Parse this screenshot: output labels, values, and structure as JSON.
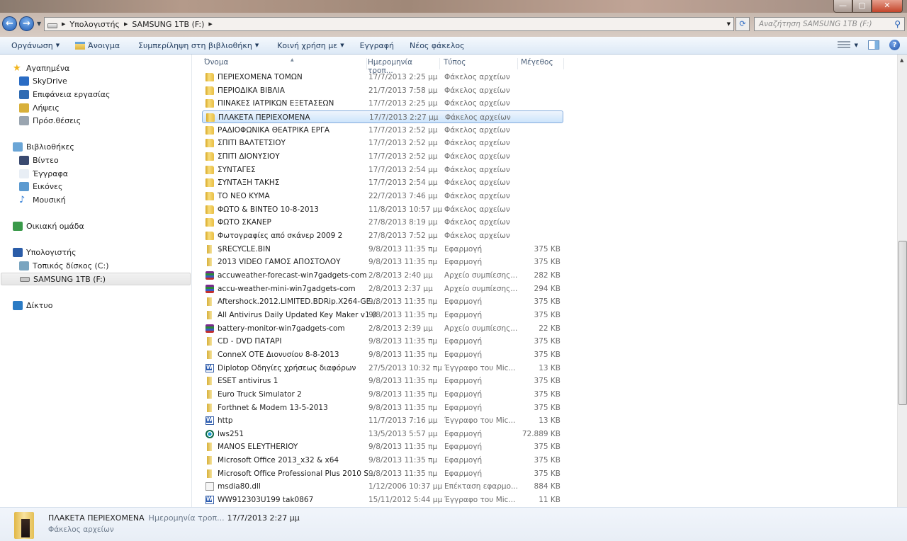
{
  "window": {
    "minimize": "—",
    "maximize": "▢",
    "close": "✕"
  },
  "address": {
    "crumbs": [
      "Υπολογιστής",
      "SAMSUNG 1TB (F:)"
    ]
  },
  "search": {
    "placeholder": "Αναζήτηση SAMSUNG 1TB (F:)"
  },
  "toolbar": {
    "organize": "Οργάνωση",
    "open": "Άνοιγμα",
    "include_library": "Συμπερίληψη στη βιβλιοθήκη",
    "share_with": "Κοινή χρήση με",
    "burn": "Εγγραφή",
    "new_folder": "Νέος φάκελος"
  },
  "nav": {
    "items": [
      {
        "label": "Αγαπημένα",
        "icon": "star-icon",
        "level": 0
      },
      {
        "label": "SkyDrive",
        "icon": "skydrive-icon",
        "level": 1
      },
      {
        "label": "Επιφάνεια εργασίας",
        "icon": "desktop-icon",
        "level": 1
      },
      {
        "label": "Λήψεις",
        "icon": "downloads-icon",
        "level": 1
      },
      {
        "label": "Πρόσ.θέσεις",
        "icon": "recent-places-icon",
        "level": 1
      },
      {
        "label": "Βιβλιοθήκες",
        "icon": "libraries-icon",
        "level": 0
      },
      {
        "label": "Βίντεο",
        "icon": "video-icon",
        "level": 1
      },
      {
        "label": "Έγγραφα",
        "icon": "documents-icon",
        "level": 1
      },
      {
        "label": "Εικόνες",
        "icon": "pictures-icon",
        "level": 1
      },
      {
        "label": "Μουσική",
        "icon": "music-icon",
        "level": 1
      },
      {
        "label": "Οικιακή ομάδα",
        "icon": "homegroup-icon",
        "level": 0
      },
      {
        "label": "Υπολογιστής",
        "icon": "computer-icon",
        "level": 0
      },
      {
        "label": "Τοπικός δίσκος (C:)",
        "icon": "local-disk-icon",
        "level": 1
      },
      {
        "label": "SAMSUNG 1TB (F:)",
        "icon": "drive-icon",
        "level": 1,
        "selected": true
      },
      {
        "label": "Δίκτυο",
        "icon": "network-icon",
        "level": 0
      }
    ]
  },
  "columns": {
    "name": "Όνομα",
    "date": "Ημερομηνία τροπ...",
    "type": "Τύπος",
    "size": "Μέγεθος"
  },
  "files": [
    {
      "name": "ΠΕΡΙΕΧΟΜΕΝΑ   ΤΟΜΩΝ",
      "date": "17/7/2013 2:25 μμ",
      "type": "Φάκελος αρχείων",
      "size": "",
      "icon": "folder"
    },
    {
      "name": "ΠΕΡΙΟΔΙΚΑ ΒΙΒΛΙΑ",
      "date": "21/7/2013 7:58 μμ",
      "type": "Φάκελος αρχείων",
      "size": "",
      "icon": "folder"
    },
    {
      "name": "ΠΙΝΑΚΕΣ ΙΑΤΡΙΚΩΝ ΕΞΕΤΑΣΕΩΝ",
      "date": "17/7/2013 2:25 μμ",
      "type": "Φάκελος αρχείων",
      "size": "",
      "icon": "folder"
    },
    {
      "name": "ΠΛΑΚΕΤΑ ΠΕΡΙΕΧΟΜΕΝΑ",
      "date": "17/7/2013 2:27 μμ",
      "type": "Φάκελος αρχείων",
      "size": "",
      "icon": "folder",
      "selected": true
    },
    {
      "name": "ΡΑΔΙΟΦΩΝΙΚΑ ΘΕΑΤΡΙΚΑ ΕΡΓΑ",
      "date": "17/7/2013 2:52 μμ",
      "type": "Φάκελος αρχείων",
      "size": "",
      "icon": "folder"
    },
    {
      "name": "ΣΠΙΤΙ ΒΑΛΤΕΤΣΙΟΥ",
      "date": "17/7/2013 2:52 μμ",
      "type": "Φάκελος αρχείων",
      "size": "",
      "icon": "folder"
    },
    {
      "name": "ΣΠΙΤΙ ΔΙΟΝΥΣΙΟΥ",
      "date": "17/7/2013 2:52 μμ",
      "type": "Φάκελος αρχείων",
      "size": "",
      "icon": "folder"
    },
    {
      "name": "ΣΥΝΤΑΓΕΣ",
      "date": "17/7/2013 2:54 μμ",
      "type": "Φάκελος αρχείων",
      "size": "",
      "icon": "folder"
    },
    {
      "name": "ΣΥΝΤΑΞΗ ΤΑΚΗΣ",
      "date": "17/7/2013 2:54 μμ",
      "type": "Φάκελος αρχείων",
      "size": "",
      "icon": "folder"
    },
    {
      "name": "ΤΟ ΝΕΟ ΚΥΜΑ",
      "date": "22/7/2013 7:46 μμ",
      "type": "Φάκελος αρχείων",
      "size": "",
      "icon": "folder"
    },
    {
      "name": "ΦΩΤΟ & ΒΙΝΤΕΟ 10-8-2013",
      "date": "11/8/2013 10:57 μμ",
      "type": "Φάκελος αρχείων",
      "size": "",
      "icon": "folder"
    },
    {
      "name": "ΦΩΤΟ ΣΚΑΝΕΡ",
      "date": "27/8/2013 8:19 μμ",
      "type": "Φάκελος αρχείων",
      "size": "",
      "icon": "folder"
    },
    {
      "name": "Φωτογραφίες από σκάνερ 2009 2",
      "date": "27/8/2013 7:52 μμ",
      "type": "Φάκελος αρχείων",
      "size": "",
      "icon": "folder"
    },
    {
      "name": "$RECYCLE.BIN",
      "date": "9/8/2013 11:35 πμ",
      "type": "Εφαρμογή",
      "size": "375 KB",
      "icon": "app"
    },
    {
      "name": "2013 VIDEO ΓΑΜΟΣ ΑΠΟΣΤΟΛΟΥ",
      "date": "9/8/2013 11:35 πμ",
      "type": "Εφαρμογή",
      "size": "375 KB",
      "icon": "app"
    },
    {
      "name": "accuweather-forecast-win7gadgets-com",
      "date": "2/8/2013 2:40 μμ",
      "type": "Αρχείο συμπίεσης...",
      "size": "282 KB",
      "icon": "rar"
    },
    {
      "name": "accu-weather-mini-win7gadgets-com",
      "date": "2/8/2013 2:37 μμ",
      "type": "Αρχείο συμπίεσης...",
      "size": "294 KB",
      "icon": "rar"
    },
    {
      "name": "Aftershock.2012.LIMITED.BDRip.X264-GE...",
      "date": "9/8/2013 11:35 πμ",
      "type": "Εφαρμογή",
      "size": "375 KB",
      "icon": "app"
    },
    {
      "name": "All Antivirus Daily Updated Key Maker v1.0",
      "date": "9/8/2013 11:35 πμ",
      "type": "Εφαρμογή",
      "size": "375 KB",
      "icon": "app"
    },
    {
      "name": "battery-monitor-win7gadgets-com",
      "date": "2/8/2013 2:39 μμ",
      "type": "Αρχείο συμπίεσης...",
      "size": "22 KB",
      "icon": "rar"
    },
    {
      "name": "CD - DVD ΠΑΤΑΡΙ",
      "date": "9/8/2013 11:35 πμ",
      "type": "Εφαρμογή",
      "size": "375 KB",
      "icon": "app"
    },
    {
      "name": "ConneX OTE Διονυσίου  8-8-2013",
      "date": "9/8/2013 11:35 πμ",
      "type": "Εφαρμογή",
      "size": "375 KB",
      "icon": "app"
    },
    {
      "name": "Diplotop Οδηγίες χρήσεως διαφόρων",
      "date": "27/5/2013 10:32 πμ",
      "type": "Έγγραφο του Mic...",
      "size": "13 KB",
      "icon": "doc"
    },
    {
      "name": "ESET antivirus 1",
      "date": "9/8/2013 11:35 πμ",
      "type": "Εφαρμογή",
      "size": "375 KB",
      "icon": "app"
    },
    {
      "name": "Euro Truck Simulator 2",
      "date": "9/8/2013 11:35 πμ",
      "type": "Εφαρμογή",
      "size": "375 KB",
      "icon": "app"
    },
    {
      "name": "Forthnet & Modem 13-5-2013",
      "date": "9/8/2013 11:35 πμ",
      "type": "Εφαρμογή",
      "size": "375 KB",
      "icon": "app"
    },
    {
      "name": "http",
      "date": "11/7/2013 7:16 μμ",
      "type": "Έγγραφο του Mic...",
      "size": "13 KB",
      "icon": "doc"
    },
    {
      "name": "lws251",
      "date": "13/5/2013 5:57 μμ",
      "type": "Εφαρμογή",
      "size": "72.889 KB",
      "icon": "lws"
    },
    {
      "name": "MANOS ELEYTHERIOY",
      "date": "9/8/2013 11:35 πμ",
      "type": "Εφαρμογή",
      "size": "375 KB",
      "icon": "app"
    },
    {
      "name": "Microsoft Office 2013_x32 & x64",
      "date": "9/8/2013 11:35 πμ",
      "type": "Εφαρμογή",
      "size": "375 KB",
      "icon": "app"
    },
    {
      "name": "Microsoft Office Professional Plus 2010 S...",
      "date": "9/8/2013 11:35 πμ",
      "type": "Εφαρμογή",
      "size": "375 KB",
      "icon": "app"
    },
    {
      "name": "msdia80.dll",
      "date": "1/12/2006 10:37 μμ",
      "type": "Επέκταση εφαρμο...",
      "size": "884 KB",
      "icon": "dll"
    },
    {
      "name": "WW912303U199     tak0867",
      "date": "15/11/2012 5:44 μμ",
      "type": "Έγγραφο του Mic...",
      "size": "11 KB",
      "icon": "doc"
    }
  ],
  "status": {
    "name": "ΠΛΑΚΕΤΑ ΠΕΡΙΕΧΟΜΕΝΑ",
    "date_label": "Ημερομηνία τροπ...",
    "date_value": "17/7/2013 2:27 μμ",
    "type": "Φάκελος αρχείων"
  }
}
